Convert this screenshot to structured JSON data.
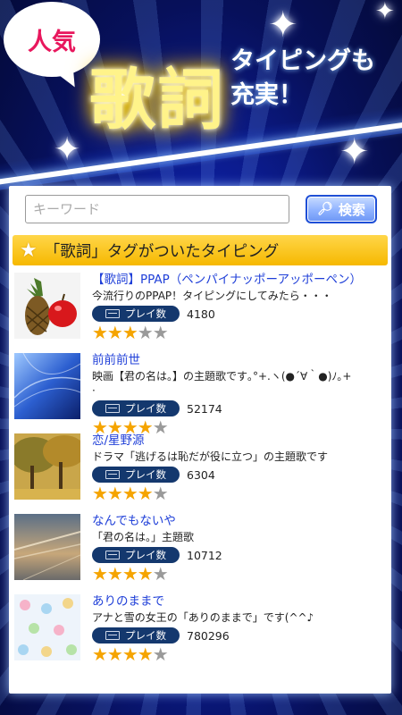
{
  "header": {
    "badge": "人気",
    "headline": "歌詞",
    "sub_line1": "タイピングも",
    "sub_line2": "充実！"
  },
  "search": {
    "placeholder": "キーワード",
    "value": "",
    "button_label": "検索"
  },
  "tag_section": {
    "title": "「歌詞」タグがついたタイピング"
  },
  "play_label": "プレイ数",
  "items": [
    {
      "title": "【歌詞】PPAP（ペンパイナッポーアッポーペン）",
      "description": "今流行りのPPAP！タイピングにしてみたら・・・",
      "play_count": "4180",
      "rating": 3
    },
    {
      "title": "前前前世",
      "description": "映画【君の名は。】の主題歌です｡°+.ヽ(●´∀｀●)ﾉ｡+",
      "description_2": "·",
      "play_count": "52174",
      "rating": 4
    },
    {
      "title": "恋/星野源",
      "description": "ドラマ「逃げるは恥だが役に立つ」の主題歌です",
      "play_count": "6304",
      "rating": 4
    },
    {
      "title": "なんでもないや",
      "description": "「君の名は。」主題歌",
      "play_count": "10712",
      "rating": 4
    },
    {
      "title": "ありのままで",
      "description": "アナと雪の女王の「ありのままで」です(^^♪",
      "play_count": "780296",
      "rating": 4
    }
  ]
}
